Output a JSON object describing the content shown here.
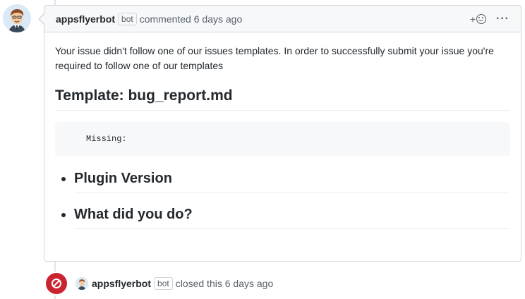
{
  "comment": {
    "author": "appsflyerbot",
    "author_label": "bot",
    "action_text": "commented 6 days ago",
    "reaction_plus": "+",
    "more_icon": "kebab-horizontal-icon",
    "body_text": "Your issue didn't follow one of our issues templates. In order to successfully submit your issue you're required to follow one of our templates",
    "template_heading": "Template: bug_report.md",
    "code": "Missing:",
    "missing_items": [
      "Plugin Version",
      "What did you do?"
    ]
  },
  "event": {
    "icon": "circle-slash-icon",
    "author": "appsflyerbot",
    "author_label": "bot",
    "action_text": "closed this 6 days ago"
  },
  "colors": {
    "closed_red": "#cb2431",
    "header_bg": "#f6f8fa",
    "border": "#d1d5da"
  }
}
